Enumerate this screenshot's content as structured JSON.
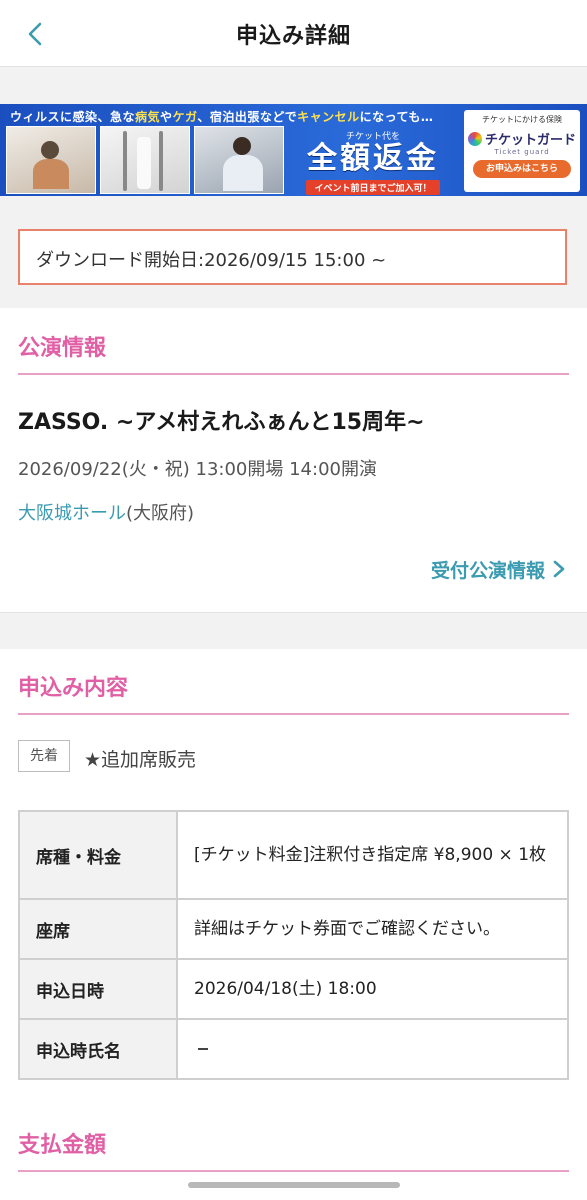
{
  "header": {
    "title": "申込み詳細"
  },
  "banner": {
    "headline_parts": [
      "ウィルスに感染、急な",
      "病気",
      "や",
      "ケガ",
      "、宿泊出張などで",
      "キャンセル",
      "になっても…"
    ],
    "refund_small": "チケット代を",
    "refund_big": "全額返金",
    "refund_note": "イベント前日までご加入可！",
    "guard_small": "チケットにかける保険",
    "guard_logo": "チケットガード",
    "guard_sub": "Ticket guard",
    "guard_button": "お申込みはこちら"
  },
  "download": {
    "text": "ダウンロード開始日:2026/09/15 15:00 ~"
  },
  "performance": {
    "section_title": "公演情報",
    "title": "ZASSO. ~アメ村えれふぁんと15周年~",
    "datetime": "2026/09/22(火・祝) 13:00開場 14:00開演",
    "venue_link": "大阪城ホール",
    "venue_pref": "(大阪府)",
    "info_link": "受付公演情報"
  },
  "application": {
    "section_title": "申込み内容",
    "badge": "先着",
    "sale_type": "★追加席販売",
    "rows": [
      {
        "label": "席種・料金",
        "value": "[チケット料金]注釈付き指定席 ¥8,900 × 1枚"
      },
      {
        "label": "座席",
        "value": "詳細はチケット券面でご確認ください。"
      },
      {
        "label": "申込日時",
        "value": "2026/04/18(土) 18:00"
      },
      {
        "label": "申込時氏名",
        "value": ""
      }
    ]
  },
  "payment": {
    "section_title": "支払金額"
  },
  "colors": {
    "accent_pink": "#e05fa5",
    "link_teal": "#3b9bb0",
    "download_border": "#e8826a"
  }
}
